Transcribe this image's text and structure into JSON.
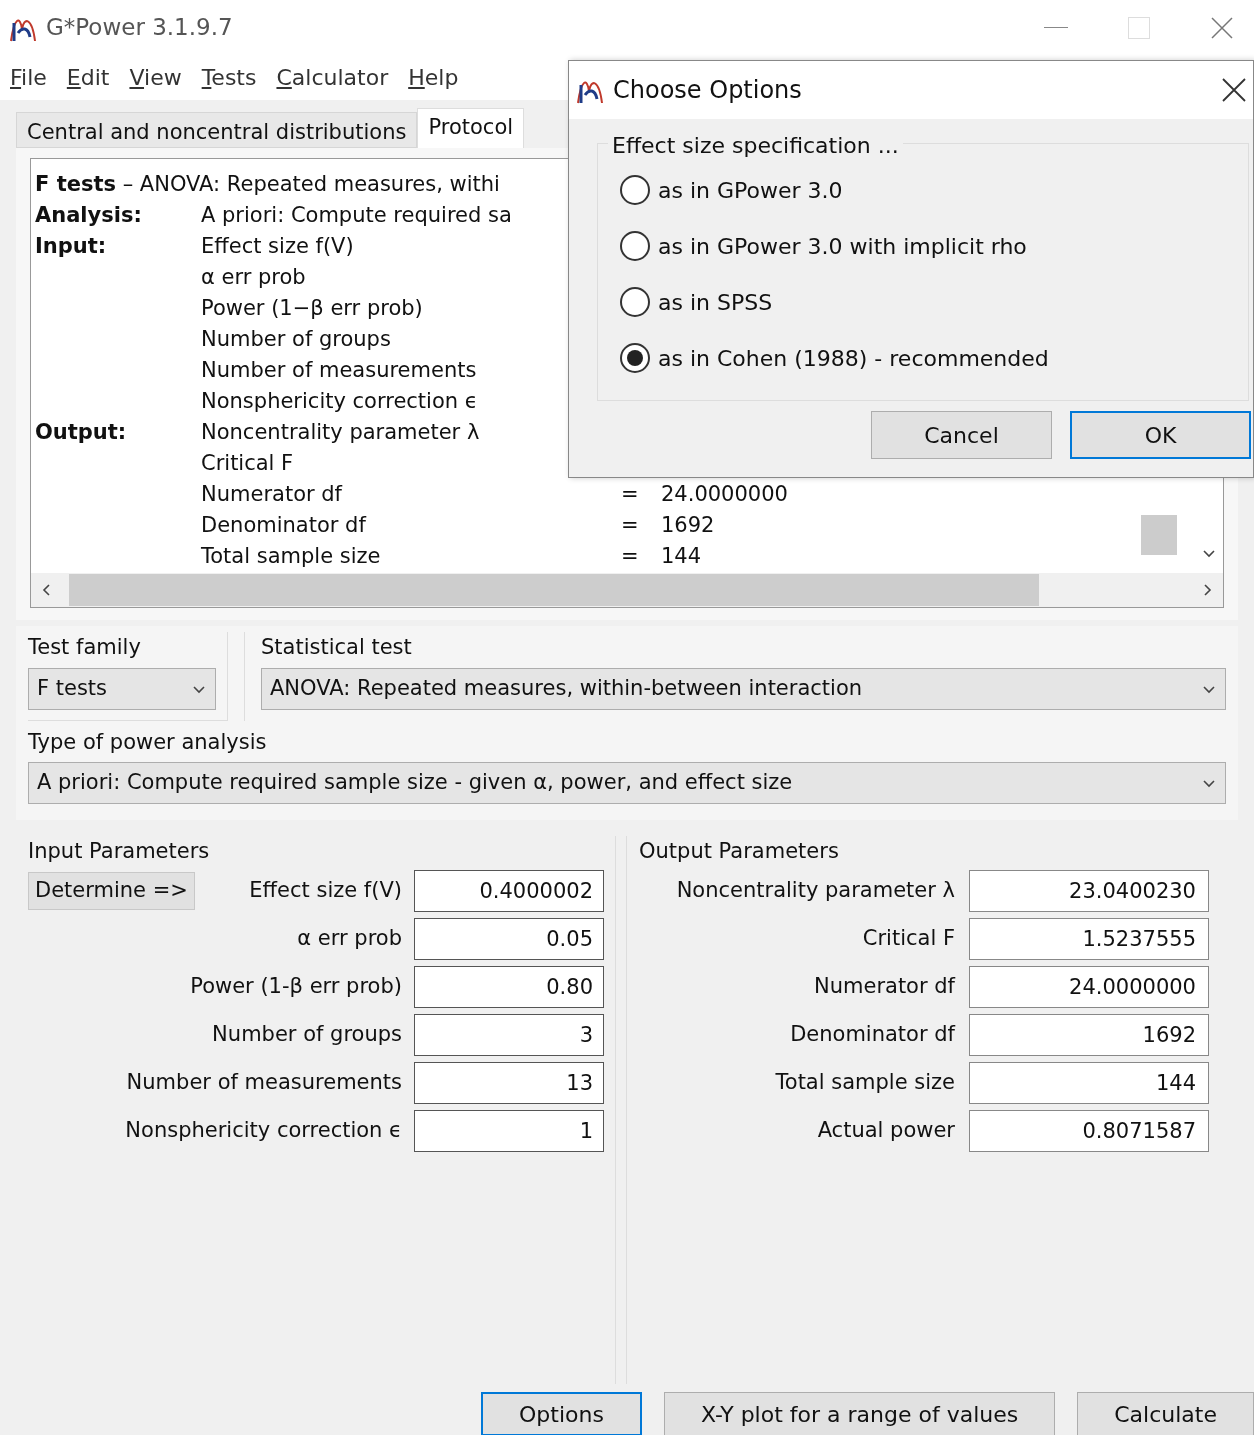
{
  "window": {
    "title": "G*Power 3.1.9.7"
  },
  "menu": [
    "File",
    "Edit",
    "View",
    "Tests",
    "Calculator",
    "Help"
  ],
  "tabs": [
    {
      "label": "Central and noncentral distributions",
      "selected": false
    },
    {
      "label": "Protocol",
      "selected": true
    }
  ],
  "protocol": {
    "header": "**F tests** – ANOVA: Repeated measures, withi",
    "rows": [
      {
        "section": "Analysis:",
        "label": "A priori: Compute required sa"
      },
      {
        "section": "Input:",
        "label": "Effect size f(V)"
      },
      {
        "label": "α err prob"
      },
      {
        "label": "Power (1−β err prob)"
      },
      {
        "label": "Number of groups"
      },
      {
        "label": "Number of measurements"
      },
      {
        "label": "Nonsphericity correction ϵ"
      },
      {
        "section": "Output:",
        "label": "Noncentrality parameter λ"
      },
      {
        "label": "Critical F"
      },
      {
        "label": "Numerator df",
        "sign": "=",
        "value": "24.0000000"
      },
      {
        "label": "Denominator df",
        "sign": "=",
        "value": "1692"
      },
      {
        "label": "Total sample size",
        "sign": "=",
        "value": "144"
      }
    ]
  },
  "test_family": {
    "label": "Test family",
    "value": "F tests"
  },
  "statistical_test": {
    "label": "Statistical test",
    "value": "ANOVA: Repeated measures, within-between interaction"
  },
  "power_analysis": {
    "label": "Type of power analysis",
    "value": "A priori: Compute required sample size - given α, power, and effect size"
  },
  "input_parameters": {
    "title": "Input Parameters",
    "determine_button": "Determine =>",
    "fields": [
      {
        "label": "Effect size f(V)",
        "value": "0.4000002"
      },
      {
        "label": "α err prob",
        "value": "0.05"
      },
      {
        "label": "Power (1-β err prob)",
        "value": "0.80"
      },
      {
        "label": "Number of groups",
        "value": "3"
      },
      {
        "label": "Number of measurements",
        "value": "13"
      },
      {
        "label": "Nonsphericity correction ϵ",
        "value": "1"
      }
    ]
  },
  "output_parameters": {
    "title": "Output Parameters",
    "fields": [
      {
        "label": "Noncentrality parameter λ",
        "value": "23.0400230"
      },
      {
        "label": "Critical F",
        "value": "1.5237555"
      },
      {
        "label": "Numerator df",
        "value": "24.0000000"
      },
      {
        "label": "Denominator df",
        "value": "1692"
      },
      {
        "label": "Total sample size",
        "value": "144"
      },
      {
        "label": "Actual power",
        "value": "0.8071587"
      }
    ]
  },
  "buttons": [
    {
      "label": "Options",
      "focused": true
    },
    {
      "label": "X-Y plot for a range of values",
      "focused": false
    },
    {
      "label": "Calculate",
      "focused": false
    }
  ],
  "dialog": {
    "title": "Choose Options",
    "group": "Effect size specification ...",
    "options": [
      {
        "label": "as in GPower 3.0",
        "selected": false
      },
      {
        "label": "as in GPower 3.0 with implicit rho",
        "selected": false
      },
      {
        "label": "as in SPSS",
        "selected": false
      },
      {
        "label": "as in Cohen (1988) - recommended",
        "selected": true
      }
    ],
    "buttons": [
      {
        "label": "Cancel",
        "focused": false
      },
      {
        "label": "OK",
        "focused": true
      }
    ]
  }
}
